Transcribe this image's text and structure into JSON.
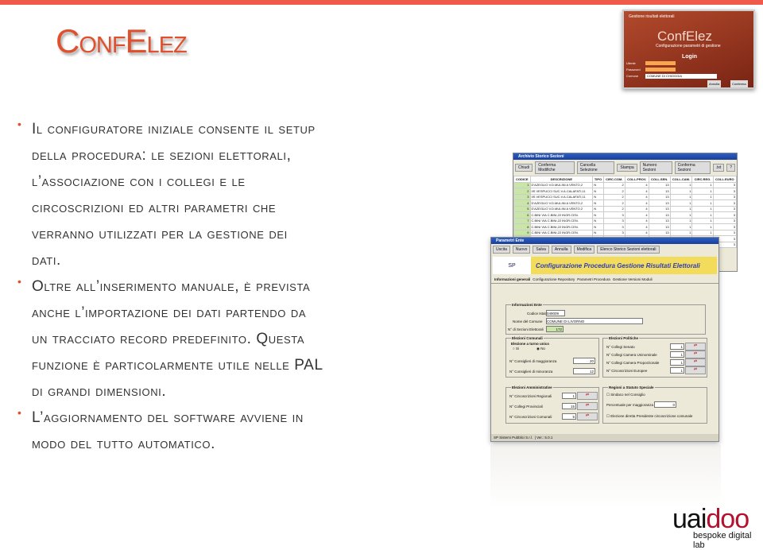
{
  "slide": {
    "title": "ConfElez",
    "accent": "#e0502c",
    "bullets": [
      {
        "lines": [
          "Il configuratore iniziale consente il setup",
          "della procedura: le sezioni elettorali,",
          "l’associazione con i collegi e le",
          "circoscrizioni ed altri parametri che",
          "verranno utilizzati per la gestione dei",
          "dati."
        ]
      },
      {
        "lines": [
          "Oltre all’inserimento manuale, è prevista",
          "anche l’importazione dei dati partendo da",
          "un tracciato record predefinito. Questa",
          "funzione è particolarmente utile nelle PAL",
          "di grandi dimensioni."
        ]
      },
      {
        "lines": [
          "L’aggiornamento del software avviene in",
          "modo del tutto automatico."
        ]
      }
    ]
  },
  "login": {
    "header": "Gestione risultati elettorali",
    "brand": "ConfElez",
    "subtitle": "Configurazione parametri di gestione",
    "heading": "Login",
    "user_label": "Utente",
    "password_label": "Password",
    "comune_label": "Comune",
    "comune_value": "COMUNE DI CHIOGGIA",
    "cancel": "Annulla",
    "confirm": "Conferma"
  },
  "archivio": {
    "title": "Archivio Storico Sezioni",
    "toolbar": [
      "Chiudi",
      "Conferma Modifiche",
      "Cancella Selezione",
      "Stampa",
      "Numero Sezioni",
      "Conferma Sezioni",
      ".txt",
      "?"
    ],
    "columns": [
      "CODICE",
      "DESCRIZIONE",
      "TIPO",
      "CIRC.COM.",
      "COLL.PROV.",
      "COLL.SEN.",
      "COLL.CAM.",
      "CIRC.REG.",
      "COLL.EURO"
    ],
    "rows": [
      [
        "1",
        "D'AZEGLIO V.D.MULINI A VENTO,2",
        "N",
        "2",
        "4",
        "13",
        "1",
        "1",
        "3"
      ],
      [
        "2",
        "IIS VESPUCCI SUC.V.A.CALAFATI,11",
        "N",
        "2",
        "4",
        "13",
        "1",
        "1",
        "3"
      ],
      [
        "3",
        "IIS VESPUCCI SUC.V.A.CALAFATI,11",
        "N",
        "2",
        "4",
        "13",
        "1",
        "1",
        "3"
      ],
      [
        "4",
        "D'AZEGLIO V.D.MULINI A VENTO,2",
        "N",
        "2",
        "4",
        "13",
        "1",
        "1",
        "3"
      ],
      [
        "5",
        "D'AZEGLIO V.D.MULINI A VENTO,2",
        "N",
        "2",
        "4",
        "13",
        "1",
        "1",
        "3"
      ],
      [
        "6",
        "C.BINI VIA C.BINI,22 INGR.CEN.",
        "N",
        "3",
        "4",
        "13",
        "1",
        "1",
        "3"
      ],
      [
        "7",
        "C.BINI VIA C.BINI,22 INGR.CEN.",
        "N",
        "3",
        "4",
        "13",
        "1",
        "1",
        "3"
      ],
      [
        "8",
        "C.BINI VIA C.BINI,22 INGR.CEN.",
        "N",
        "3",
        "4",
        "13",
        "1",
        "1",
        "3"
      ],
      [
        "9",
        "C.BINI VIA C.BINI,22 INGR.CEN.",
        "N",
        "3",
        "4",
        "13",
        "1",
        "1",
        "3"
      ],
      [
        "10",
        "C.BINI VIA C.BINI,22 INGR.CEN.",
        "N",
        "3",
        "4",
        "13",
        "1",
        "1",
        "3"
      ],
      [
        "11",
        "C.BINI VIA C.BINI,22 INGR.CEN.",
        "N",
        "3",
        "4",
        "13",
        "1",
        "1",
        "3"
      ]
    ]
  },
  "parametri": {
    "title": "Parametri Ente",
    "toolbar": [
      "Uscita",
      "Nuovo",
      "Salva",
      "Annulla",
      "Modifica",
      "Elenco Storico Sezioni elettorali"
    ],
    "banner": "Configurazione Procedura Gestione Risultati Elettorali",
    "tabs": [
      "Informazioni generali",
      "Configurazione Repository",
      "Parametri Procedura",
      "Gestione Versioni Moduli"
    ],
    "info": {
      "title": "Informazioni Ente",
      "codice_label": "Codice Istat",
      "codice": "049009",
      "nome_label": "Nome del Comune",
      "nome": "COMUNE DI LIVORNO",
      "sezioni_label": "N° di Sezioni Elettorali",
      "sezioni": "172"
    },
    "comunali": {
      "title": "Elezioni Comunali",
      "turno": "Elezione a turno unico",
      "si": "Si",
      "no": "No",
      "magg_label": "N° Consiglieri di maggioranza",
      "magg": "20",
      "min_label": "N° Consiglieri di minoranza",
      "min": "12"
    },
    "politiche": {
      "title": "Elezioni Politiche",
      "items": [
        {
          "label": "N° Collegi Senato",
          "value": "1"
        },
        {
          "label": "N° Collegi Camera Uninominale",
          "value": "1"
        },
        {
          "label": "N° Collegi Camera Proporzionale",
          "value": "1"
        },
        {
          "label": "N° Circoscrizioni Europee",
          "value": "1"
        }
      ]
    },
    "amministrative": {
      "title": "Elezioni Amministrative",
      "items": [
        {
          "label": "N° Circoscrizioni Regionali",
          "value": "1"
        },
        {
          "label": "N° Collegi Provinciali",
          "value": "15"
        },
        {
          "label": "N° Circoscrizioni Comunali",
          "value": "5"
        }
      ]
    },
    "speciale": {
      "title": "Regioni a Statuto Speciale",
      "sindaco": "Sindaco nel Consiglio",
      "perc_label": "Percentuale per maggioranza",
      "perc": "0",
      "diretta": "Elezione diretta Presidente circoscrizione comunale"
    },
    "status": [
      "SP Sistemi Pubblici S.r.l.",
      "Ver.: 5.0.1"
    ]
  },
  "logo": {
    "brand_a": "uai",
    "brand_b": "doo",
    "tagline": "bespoke digital lab",
    "brand_color": "#b3122e"
  }
}
